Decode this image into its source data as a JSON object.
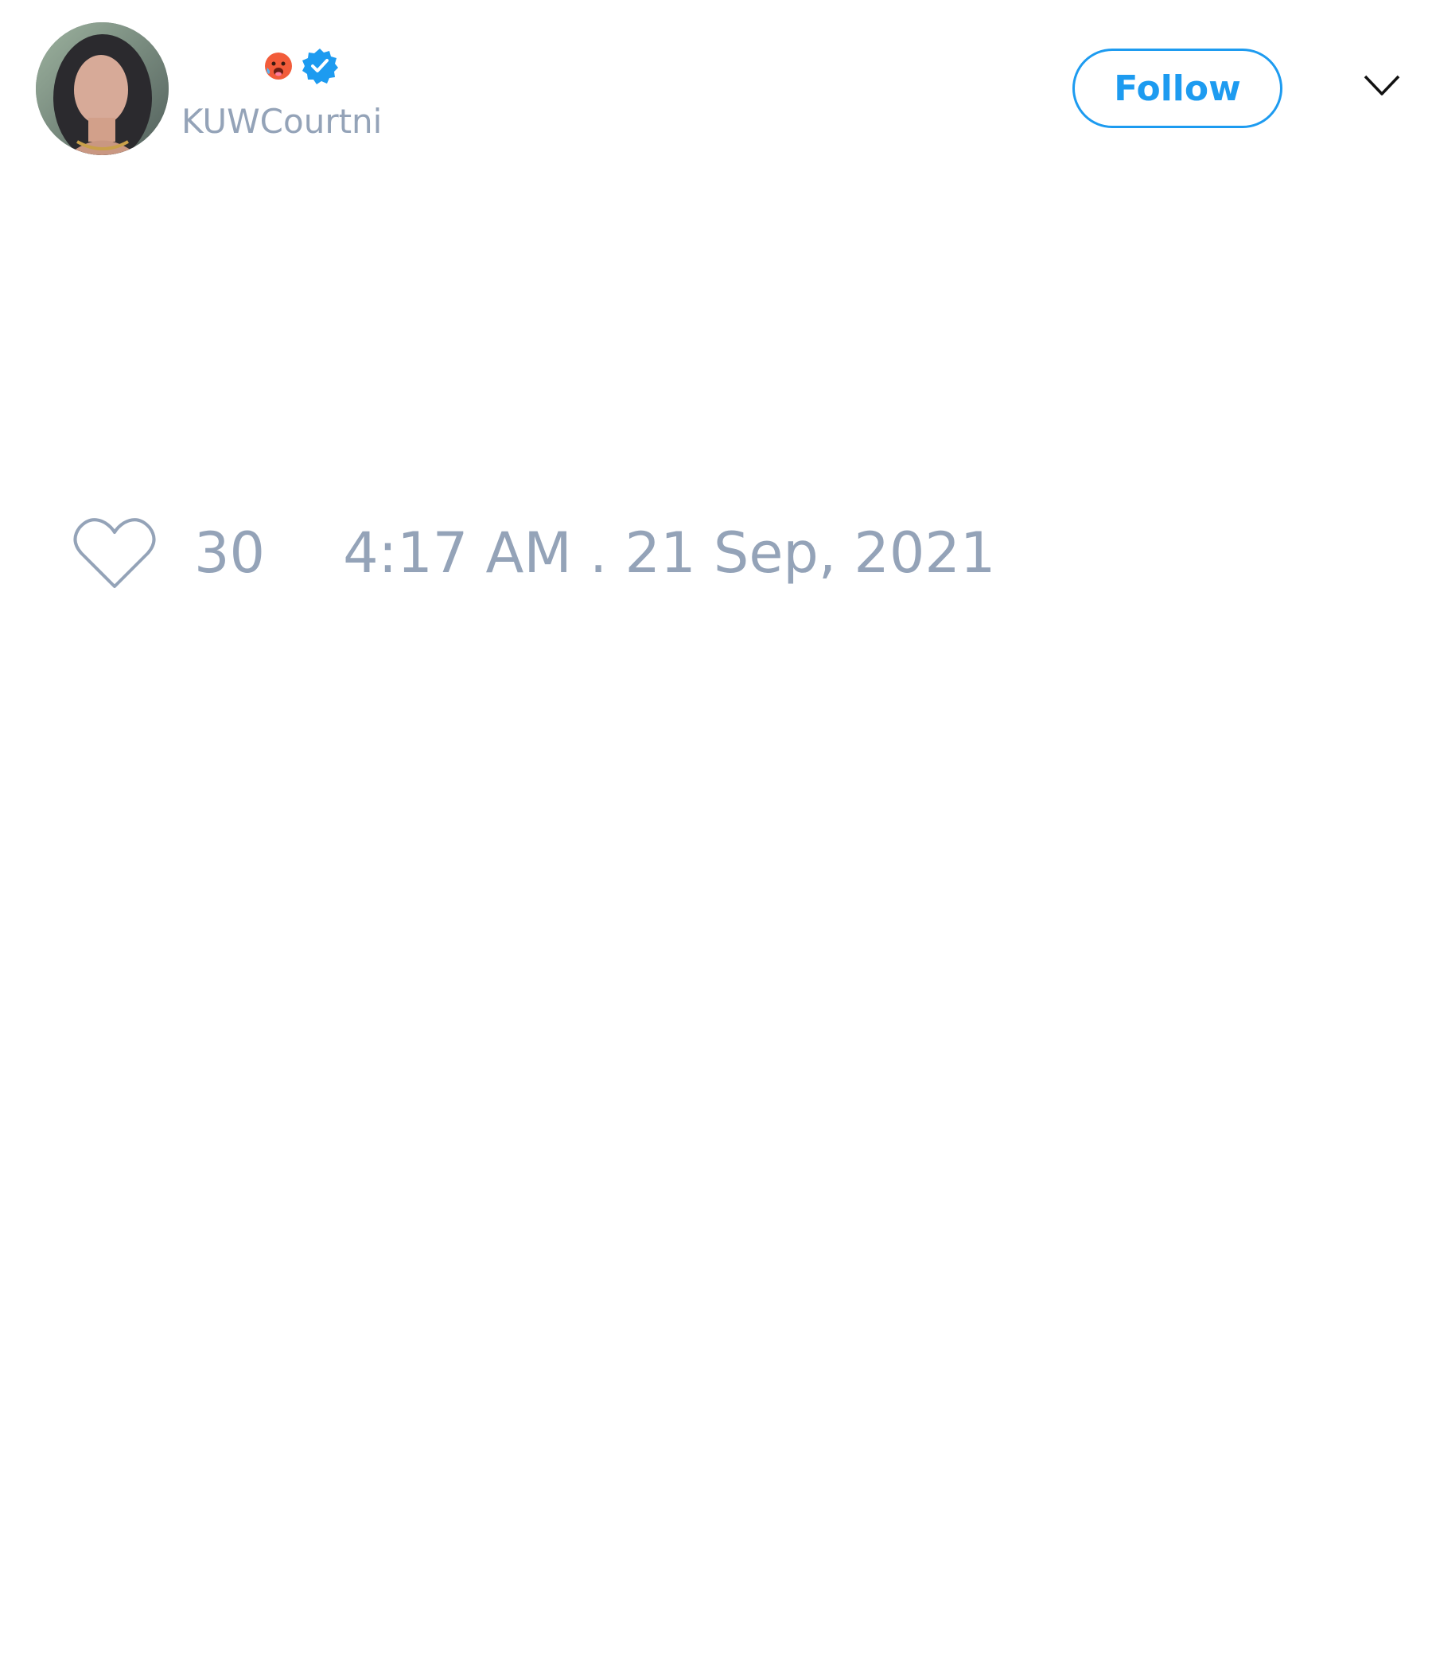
{
  "tweet": {
    "author": {
      "handle": "KUWCourtni",
      "verified": true,
      "name_emoji": "hot-face-emoji",
      "badge_icon": "verified-badge-icon"
    },
    "follow_label": "Follow",
    "menu_icon": "chevron-down-icon",
    "likes": {
      "icon": "heart-icon",
      "count": "30"
    },
    "timestamp": "4:17 AM . 21 Sep, 2021"
  },
  "colors": {
    "accent": "#1d9bf0",
    "muted_text": "#94a3b8",
    "background": "#ffffff"
  }
}
